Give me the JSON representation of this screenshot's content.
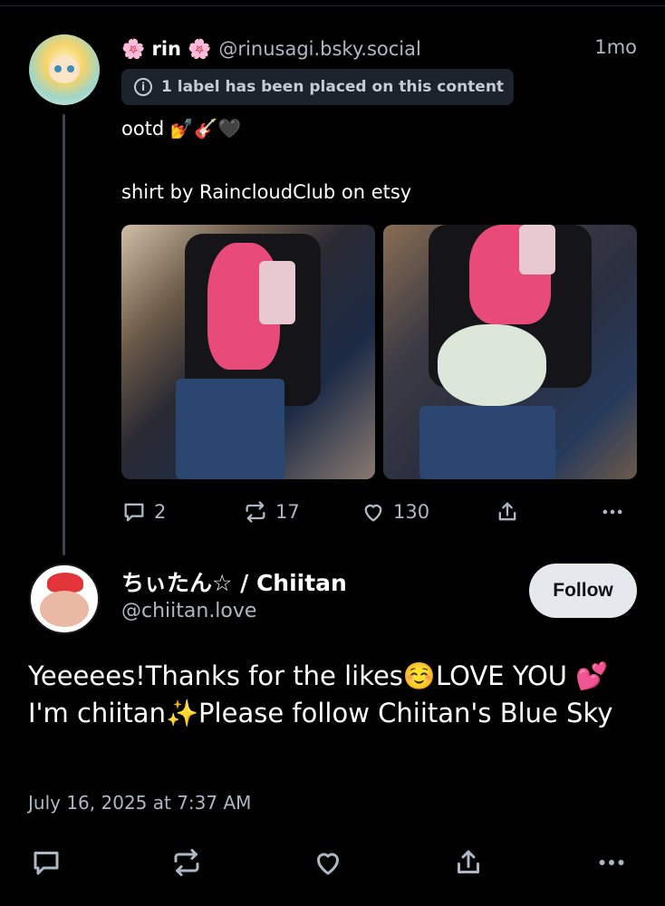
{
  "parent": {
    "display_name": "🌸 rin 🌸",
    "handle": "@rinusagi.bsky.social",
    "time": "1mo",
    "label_notice": "1 label has been placed on this content",
    "text_line1": "ootd 💅🎸🖤",
    "text_line2": "shirt by RaincloudClub on etsy",
    "stats": {
      "replies": "2",
      "reposts": "17",
      "likes": "130"
    }
  },
  "reply": {
    "display_name": "ちぃたん☆ / Chiitan",
    "handle": "@chiitan.love",
    "follow_label": "Follow",
    "text": "Yeeeees!Thanks for the likes☺️LOVE YOU 💕I'm chiitan✨Please follow Chiitan's Blue Sky",
    "date": "July 16, 2025 at 7:37 AM"
  },
  "icons": [
    "info-icon",
    "reply-icon",
    "repost-icon",
    "like-icon",
    "share-icon",
    "more-icon"
  ],
  "colors": {
    "background": "#000000",
    "muted": "#aeb8c5",
    "label_bg": "#1b232c",
    "follow_bg": "#e5e9ee"
  }
}
